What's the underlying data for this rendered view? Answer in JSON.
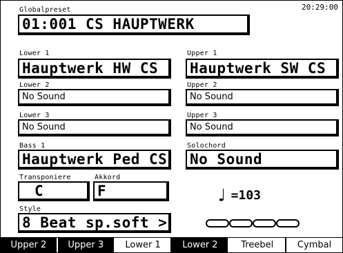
{
  "clock": "20:29:00",
  "globalpreset": {
    "label": "Globalpreset",
    "value": "01:001 CS HAUPTWERK"
  },
  "lower1": {
    "label": "Lower 1",
    "value": "Hauptwerk HW   CS"
  },
  "upper1": {
    "label": "Upper 1",
    "value": "Hauptwerk SW   CS"
  },
  "lower2": {
    "label": "Lower 2",
    "value": "No Sound"
  },
  "upper2": {
    "label": "Upper 2",
    "value": "No Sound"
  },
  "lower3": {
    "label": "Lower 3",
    "value": "No Sound"
  },
  "upper3": {
    "label": "Upper 3",
    "value": "No Sound"
  },
  "bass1": {
    "label": "Bass 1",
    "value": "Hauptwerk Ped CS"
  },
  "solochord": {
    "label": "Solochord",
    "value": "No Sound"
  },
  "transpose": {
    "label": "Transponiere",
    "value": "C"
  },
  "chord": {
    "label": "Akkord",
    "value": "F"
  },
  "tempo": {
    "value": "=103"
  },
  "style": {
    "label": "Style",
    "value": "8 Beat sp.soft >"
  },
  "tabs": [
    "Upper 2",
    "Upper 3",
    "Lower 1",
    "Lower 2",
    "Treebel",
    "Cymbal"
  ]
}
